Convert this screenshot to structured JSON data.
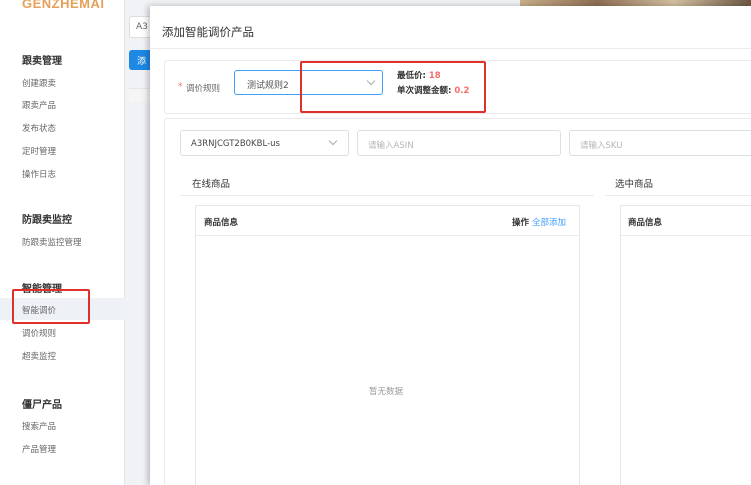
{
  "app": {
    "logo": "GENZHEMAI"
  },
  "sidebar": {
    "groups": [
      {
        "title": "跟卖管理",
        "items": [
          "创建跟卖",
          "跟卖产品",
          "发布状态",
          "定时管理",
          "操作日志"
        ]
      },
      {
        "title": "防跟卖监控",
        "items": [
          "防跟卖监控管理"
        ]
      },
      {
        "title": "智能管理",
        "items": [
          "智能调价",
          "调价规则",
          "超卖监控"
        ]
      },
      {
        "title": "僵尸产品",
        "items": [
          "搜索产品",
          "产品管理"
        ]
      }
    ],
    "active_item": "智能调价"
  },
  "background": {
    "select_text": "A3",
    "button_text": "添"
  },
  "dialog": {
    "title": "添加智能调价产品",
    "rule": {
      "required_mark": "*",
      "label": "调价规则",
      "selected": "测试规则2",
      "min_price_label": "最低价:",
      "min_price_value": "18",
      "step_label": "单次调整金额:",
      "step_value": "0.2"
    },
    "filters": {
      "shop_selected": "A3RNJCGT2B0KBL-us",
      "asin_placeholder": "请输入ASIN",
      "sku_placeholder": "请输入SKU"
    },
    "online_panel": {
      "title": "在线商品",
      "col_info": "商品信息",
      "col_op": "操作",
      "add_all": "全部添加",
      "empty": "暂无数据"
    },
    "selected_panel": {
      "title": "选中商品",
      "col_info": "商品信息"
    }
  },
  "colors": {
    "accent": "#409eff",
    "highlight": "#e0302a",
    "price": "#f56c6c",
    "logo": "#e6a05a"
  }
}
